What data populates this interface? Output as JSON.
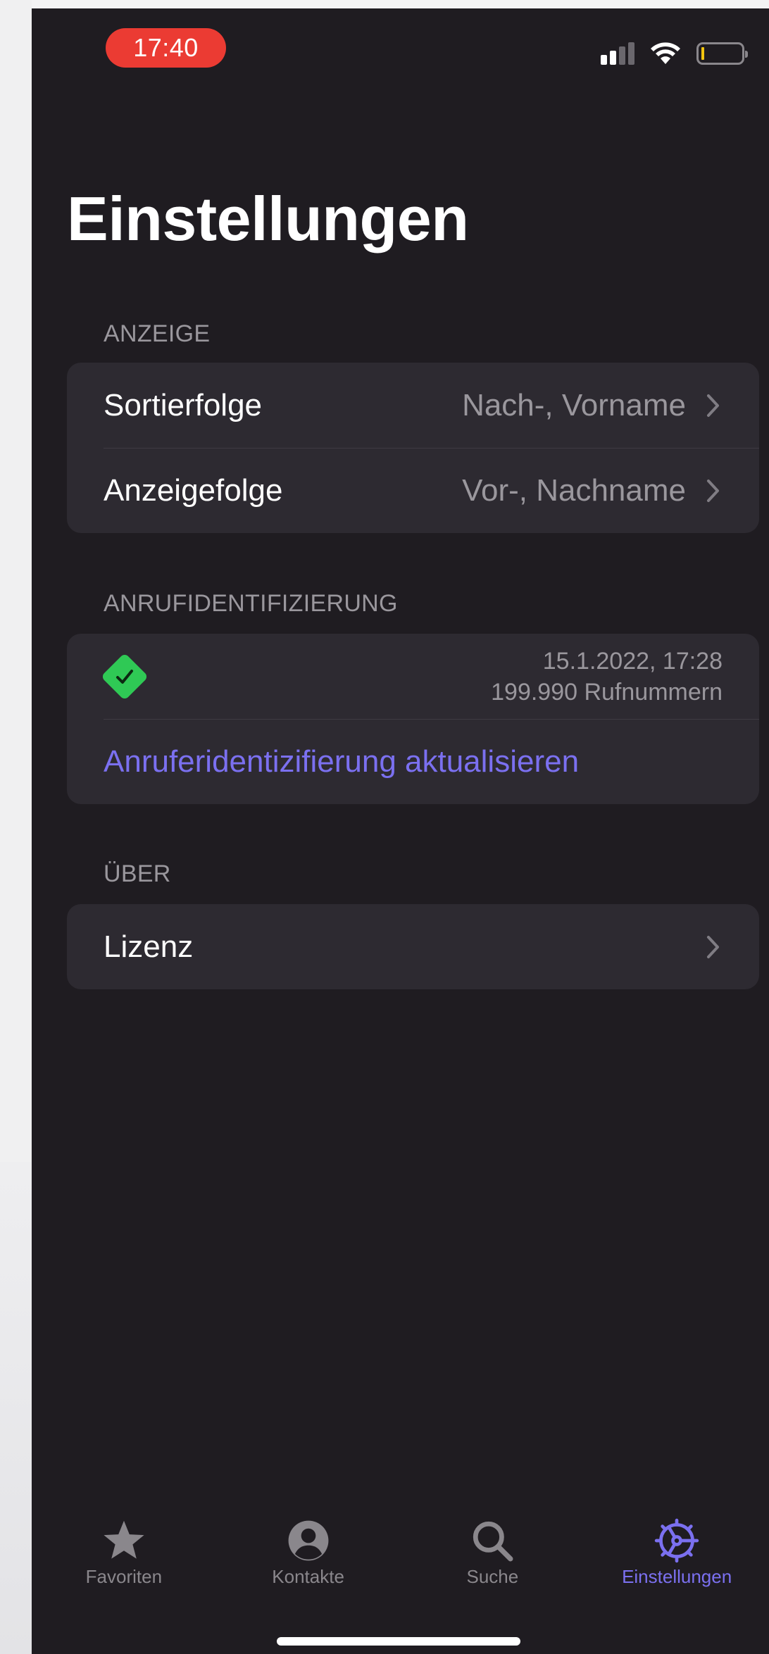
{
  "status_bar": {
    "time": "17:40",
    "icons": [
      "signal-icon",
      "wifi-icon",
      "battery-icon"
    ],
    "battery_color": "#f2c40f",
    "time_pill_color": "#eb3b33"
  },
  "page": {
    "title": "Einstellungen"
  },
  "sections": {
    "anzeige": {
      "label": "ANZEIGE",
      "rows": [
        {
          "label": "Sortierfolge",
          "value": "Nach-, Vorname"
        },
        {
          "label": "Anzeigefolge",
          "value": "Vor-, Nachname"
        }
      ]
    },
    "anrufidentifizierung": {
      "label": "ANRUFIDENTIFIZIERUNG",
      "status_icon": "checkmark-diamond-icon",
      "date": "15.1.2022, 17:28",
      "count": "199.990 Rufnummern",
      "update_link": "Anruferidentizifierung aktualisieren"
    },
    "ueber": {
      "label": "ÜBER",
      "rows": [
        {
          "label": "Lizenz"
        }
      ]
    }
  },
  "tabbar": {
    "items": [
      {
        "label": "Favoriten",
        "icon": "star-icon"
      },
      {
        "label": "Kontakte",
        "icon": "person-circle-icon"
      },
      {
        "label": "Suche",
        "icon": "search-icon"
      },
      {
        "label": "Einstellungen",
        "icon": "gear-icon",
        "active": true
      }
    ]
  },
  "colors": {
    "accent": "#7b70f0",
    "background": "#1f1c21",
    "group_background": "#2d2a31",
    "success": "#2fc955"
  }
}
